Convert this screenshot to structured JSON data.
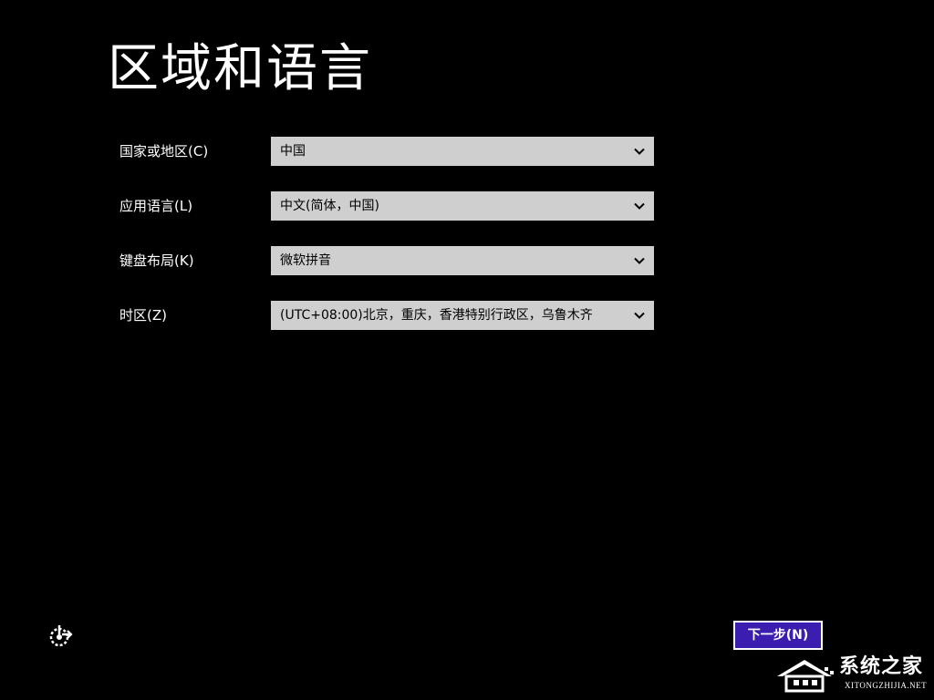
{
  "page": {
    "title": "区域和语言"
  },
  "fields": [
    {
      "label": "国家或地区(C)",
      "value": "中国"
    },
    {
      "label": "应用语言(L)",
      "value": "中文(简体，中国)"
    },
    {
      "label": "键盘布局(K)",
      "value": "微软拼音"
    },
    {
      "label": "时区(Z)",
      "value": "(UTC+08:00)北京，重庆，香港特别行政区，乌鲁木齐"
    }
  ],
  "footer": {
    "accessibility_icon": "ease-of-access-icon",
    "next_label": "下一步(N)"
  },
  "watermark": {
    "text": "系统之家",
    "subtext": "XITONGZHIJIA.NET"
  },
  "colors": {
    "background": "#000000",
    "select_background": "#cfcfcf",
    "next_button": "#3b1db0"
  }
}
